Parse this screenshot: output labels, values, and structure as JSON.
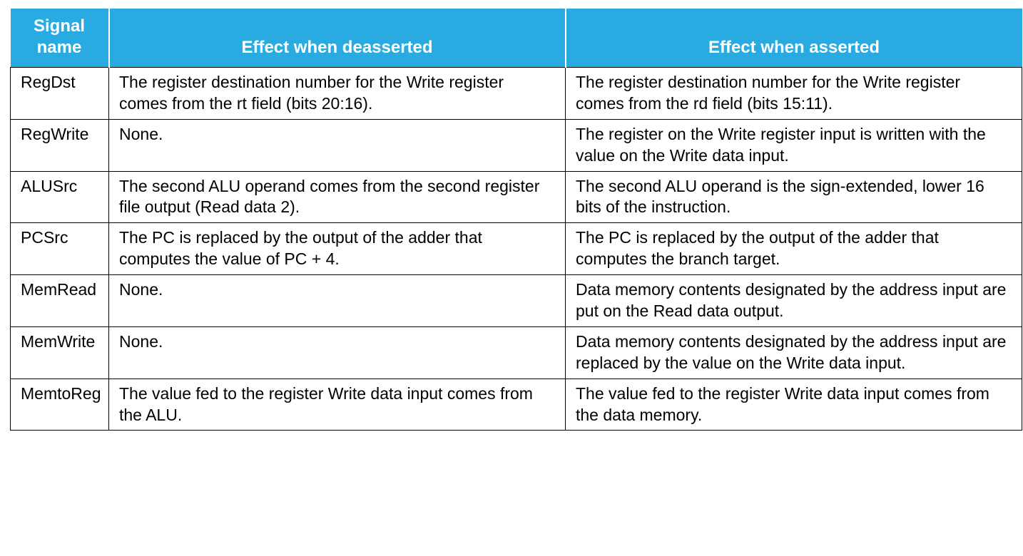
{
  "table": {
    "headers": {
      "signal": "Signal\nname",
      "deasserted": "Effect when deasserted",
      "asserted": "Effect when asserted"
    },
    "rows": [
      {
        "signal": "RegDst",
        "deasserted": "The register destination number for the Write register comes from the rt field (bits 20:16).",
        "asserted": "The register destination number for the Write register comes from the rd field (bits 15:11)."
      },
      {
        "signal": "RegWrite",
        "deasserted": "None.",
        "asserted": "The register on the Write register input is written with the value on the Write data input."
      },
      {
        "signal": "ALUSrc",
        "deasserted": "The second ALU operand comes from the second register file output (Read data 2).",
        "asserted": "The second ALU operand is the sign-extended, lower 16 bits of the instruction."
      },
      {
        "signal": "PCSrc",
        "deasserted": "The PC is replaced by the output of the adder that computes the value of PC + 4.",
        "asserted": "The PC is replaced by the output of the adder that computes the branch target."
      },
      {
        "signal": "MemRead",
        "deasserted": "None.",
        "asserted": "Data memory contents designated by the address input are put on the Read data output."
      },
      {
        "signal": "MemWrite",
        "deasserted": "None.",
        "asserted": "Data memory contents designated by the address input are replaced by the value on the Write data input."
      },
      {
        "signal": "MemtoReg",
        "deasserted": "The value fed to the register Write data input comes from the ALU.",
        "asserted": "The value fed to the register Write data input comes from the data memory."
      }
    ]
  }
}
